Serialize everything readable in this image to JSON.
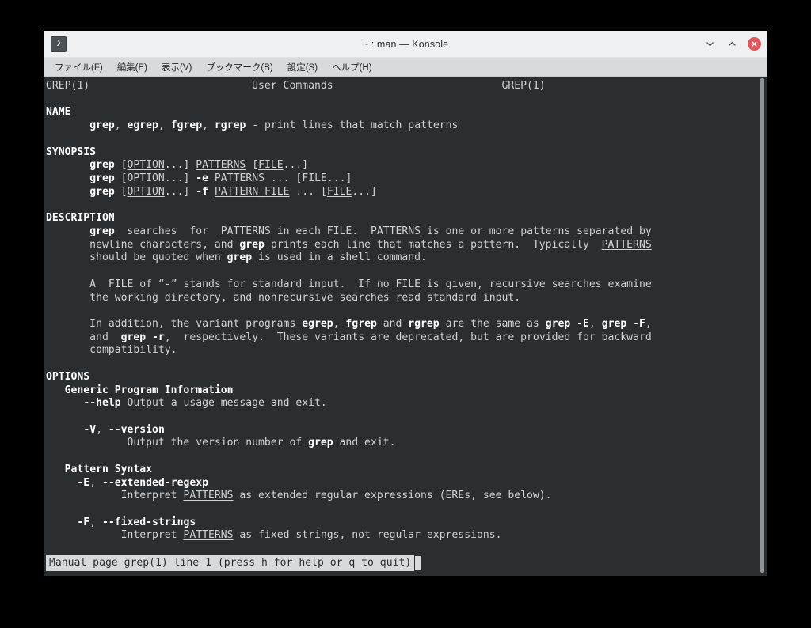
{
  "window": {
    "title": "~ : man — Konsole",
    "icon": "terminal-prompt-icon",
    "controls": {
      "minimize": "minimize",
      "maximize": "maximize",
      "close": "close"
    }
  },
  "menubar": {
    "items": [
      {
        "label": "ファイル(F)",
        "name": "menu-file"
      },
      {
        "label": "編集(E)",
        "name": "menu-edit"
      },
      {
        "label": "表示(V)",
        "name": "menu-view"
      },
      {
        "label": "ブックマーク(B)",
        "name": "menu-bookmarks"
      },
      {
        "label": "設定(S)",
        "name": "menu-settings"
      },
      {
        "label": "ヘルプ(H)",
        "name": "menu-help"
      }
    ]
  },
  "terminal": {
    "program": "man grep",
    "header": {
      "left": "GREP(1)",
      "center": "User Commands",
      "right": "GREP(1)"
    },
    "sections": [
      {
        "name": "NAME",
        "body": "grep, egrep, fgrep, rgrep - print lines that match patterns"
      },
      {
        "name": "SYNOPSIS",
        "lines": [
          "grep [OPTION...] PATTERNS [FILE...]",
          "grep [OPTION...] -e PATTERNS ... [FILE...]",
          "grep [OPTION...] -f PATTERN_FILE ... [FILE...]"
        ]
      },
      {
        "name": "DESCRIPTION",
        "paragraphs": [
          "grep  searches  for  PATTERNS in each FILE.  PATTERNS is one or more patterns separated by newline characters, and grep prints each line that matches a pattern.  Typically  PATTERNS should be quoted when grep is used in a shell command.",
          "A  FILE of “-” stands for standard input.  If no FILE is given, recursive searches examine the working directory, and nonrecursive searches read standard input.",
          "In addition, the variant programs egrep, fgrep and rgrep are the same as grep -E, grep -F, and  grep -r,  respectively.  These variants are deprecated, but are provided for backward compatibility."
        ]
      },
      {
        "name": "OPTIONS",
        "groups": [
          {
            "title": "Generic Program Information",
            "options": [
              {
                "flags": "--help",
                "desc": "Output a usage message and exit."
              },
              {
                "flags": "-V, --version",
                "desc": "Output the version number of grep and exit."
              }
            ]
          },
          {
            "title": "Pattern Syntax",
            "options": [
              {
                "flags": "-E, --extended-regexp",
                "desc": "Interpret PATTERNS as extended regular expressions (EREs, see below)."
              },
              {
                "flags": "-F, --fixed-strings",
                "desc": "Interpret PATTERNS as fixed strings, not regular expressions."
              }
            ]
          }
        ]
      }
    ],
    "status_line": "Manual page grep(1) line 1 (press h for help or q to quit)"
  },
  "colors": {
    "terminal_bg": "#2b2e31",
    "terminal_fg": "#d0d3d4",
    "titlebar_bg": "#eff0f1",
    "menubar_bg": "#d9dadb",
    "close_button": "#e0585d",
    "desktop_bg": "#000000",
    "scrollbar": "#919496"
  }
}
